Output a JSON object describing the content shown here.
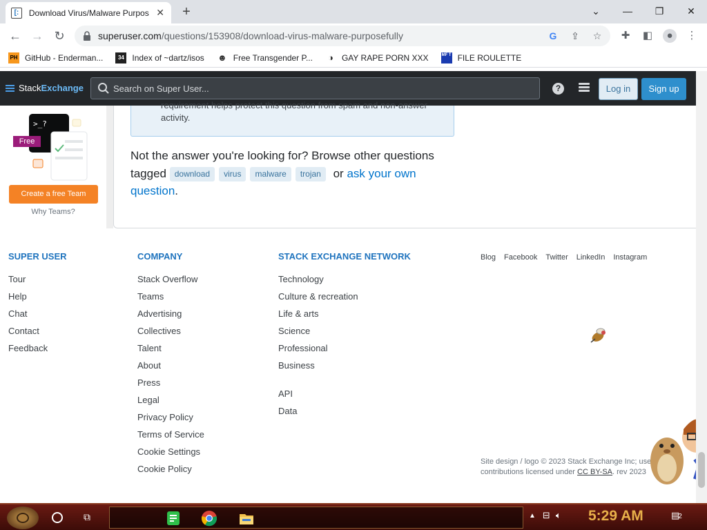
{
  "browser": {
    "tab_title": "Download Virus/Malware Purpos",
    "url_main": "superuser.com",
    "url_rest": "/questions/153908/download-virus-malware-purposefully",
    "bookmarks": [
      {
        "label": "GitHub - Enderman...",
        "icon": "PH"
      },
      {
        "label": "Index of ~dartz/isos",
        "icon": "34"
      },
      {
        "label": "Free Transgender P...",
        "icon": ""
      },
      {
        "label": "GAY RAPE PORN XXX",
        "icon": ""
      },
      {
        "label": "FILE ROULETTE",
        "icon": "MF T"
      }
    ]
  },
  "se": {
    "logo_stack": "Stack",
    "logo_exchange": "Exchange",
    "search_placeholder": "Search on Super User...",
    "help": "?",
    "login": "Log in",
    "signup": "Sign up"
  },
  "sidebar": {
    "free_badge": "Free",
    "terminal": ">_?",
    "create_team": "Create a free Team",
    "why_teams": "Why Teams?"
  },
  "main": {
    "notice_cut": "requirement helps protect this question from spam and non-answer",
    "notice_text": "activity.",
    "not_answer": "Not the answer you're looking for? Browse other questions tagged",
    "tags": [
      "download",
      "virus",
      "malware",
      "trojan"
    ],
    "or": "or",
    "ask_link": "ask your own question",
    "period": "."
  },
  "footer": {
    "col1": {
      "heading": "Super User",
      "links": [
        "Tour",
        "Help",
        "Chat",
        "Contact",
        "Feedback"
      ]
    },
    "col2": {
      "heading": "Company",
      "links": [
        "Stack Overflow",
        "Teams",
        "Advertising",
        "Collectives",
        "Talent",
        "About",
        "Press",
        "Legal",
        "Privacy Policy",
        "Terms of Service",
        "Cookie Settings",
        "Cookie Policy"
      ]
    },
    "col3": {
      "heading": "Stack Exchange Network",
      "links": [
        "Technology",
        "Culture & recreation",
        "Life & arts",
        "Science",
        "Professional",
        "Business"
      ],
      "links2": [
        "API",
        "Data"
      ]
    },
    "social": [
      "Blog",
      "Facebook",
      "Twitter",
      "LinkedIn",
      "Instagram"
    ],
    "copyright_a": "Site design / logo © 2023 Stack Exchange Inc; user",
    "copyright_b": "contributions licensed under",
    "license": "CC BY-SA",
    "rev": ". rev 2023"
  },
  "taskbar": {
    "clock": "5:29 AM",
    "notif_count": "2"
  },
  "colors": {
    "se_dark": "#232629",
    "se_blue": "#2e8fcd",
    "footer_heading": "#1e73be",
    "orange": "#f48225",
    "clock": "#e8b04a"
  }
}
